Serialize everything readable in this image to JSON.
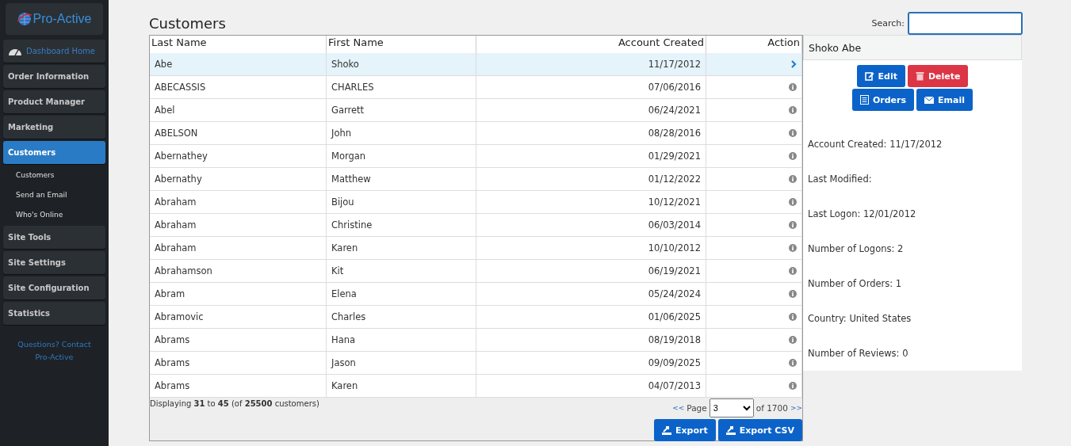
{
  "sidebar": {
    "logo": "Pro-Active",
    "items": [
      {
        "label": "Dashboard Home",
        "kind": "home",
        "selected": false
      },
      {
        "label": "Order Information",
        "kind": "section",
        "selected": false
      },
      {
        "label": "Product Manager",
        "kind": "section",
        "selected": false
      },
      {
        "label": "Marketing",
        "kind": "section",
        "selected": false
      },
      {
        "label": "Customers",
        "kind": "section",
        "selected": true,
        "children": [
          {
            "label": "Customers"
          },
          {
            "label": "Send an Email"
          },
          {
            "label": "Who's Online"
          }
        ]
      },
      {
        "label": "Site Tools",
        "kind": "section",
        "selected": false
      },
      {
        "label": "Site Settings",
        "kind": "section",
        "selected": false
      },
      {
        "label": "Site Configuration",
        "kind": "section",
        "selected": false
      },
      {
        "label": "Statistics",
        "kind": "section",
        "selected": false
      }
    ],
    "contact": "Questions? Contact Pro-Active"
  },
  "page_title": "Customers",
  "search": {
    "label": "Search:"
  },
  "table": {
    "columns": [
      "Last Name",
      "First Name",
      "Account Created",
      "Action"
    ],
    "rows": [
      {
        "last": "Abe",
        "first": "Shoko",
        "created": "11/17/2012",
        "selected": true
      },
      {
        "last": "ABECASSIS",
        "first": "CHARLES",
        "created": "07/06/2016",
        "selected": false
      },
      {
        "last": "Abel",
        "first": "Garrett",
        "created": "06/24/2021",
        "selected": false
      },
      {
        "last": "ABELSON",
        "first": "John",
        "created": "08/28/2016",
        "selected": false
      },
      {
        "last": "Abernathey",
        "first": "Morgan",
        "created": "01/29/2021",
        "selected": false
      },
      {
        "last": "Abernathy",
        "first": "Matthew",
        "created": "01/12/2022",
        "selected": false
      },
      {
        "last": "Abraham",
        "first": "Bijou",
        "created": "10/12/2021",
        "selected": false
      },
      {
        "last": "Abraham",
        "first": "Christine",
        "created": "06/03/2014",
        "selected": false
      },
      {
        "last": "Abraham",
        "first": "Karen",
        "created": "10/10/2012",
        "selected": false
      },
      {
        "last": "Abrahamson",
        "first": "Kit",
        "created": "06/19/2021",
        "selected": false
      },
      {
        "last": "Abram",
        "first": "Elena",
        "created": "05/24/2024",
        "selected": false
      },
      {
        "last": "Abramovic",
        "first": "Charles",
        "created": "01/06/2025",
        "selected": false
      },
      {
        "last": "Abrams",
        "first": "Hana",
        "created": "08/19/2018",
        "selected": false
      },
      {
        "last": "Abrams",
        "first": "Jason",
        "created": "09/09/2025",
        "selected": false
      },
      {
        "last": "Abrams",
        "first": "Karen",
        "created": "04/07/2013",
        "selected": false
      }
    ],
    "summary": "Displaying **31** to **45** (of **25500** customers)",
    "pager": {
      "prev": "<<",
      "label": "Page",
      "value": "3",
      "of": "of 1700",
      "next": ">>"
    },
    "buttons": [
      "Export",
      "Export CSV"
    ]
  },
  "detail": {
    "title": "Shoko Abe",
    "buttons": [
      {
        "label": "Edit",
        "kind": "edit"
      },
      {
        "label": "Delete",
        "kind": "delete"
      },
      {
        "label": "Orders",
        "kind": "orders"
      },
      {
        "label": "Email",
        "kind": "email"
      }
    ],
    "facts": [
      "Account Created: 11/17/2012",
      "Last Modified:",
      "Last Logon: 12/01/2012",
      "Number of Logons: 2",
      "Number of Orders: 1",
      "Country: United States",
      "Number of Reviews: 0"
    ]
  }
}
